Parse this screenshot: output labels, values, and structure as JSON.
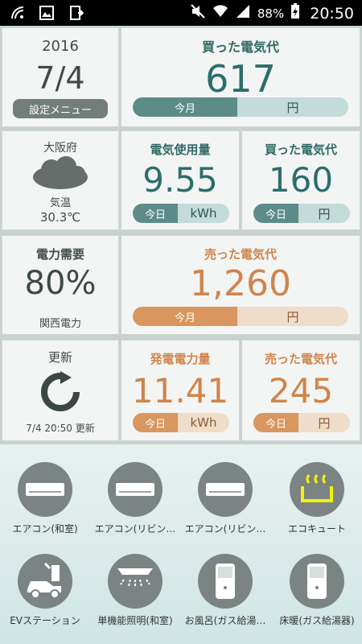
{
  "statusbar": {
    "battery": "88%",
    "time": "20:50"
  },
  "date_panel": {
    "year": "2016",
    "date": "7/4",
    "menu": "設定メニュー"
  },
  "bought_month": {
    "title": "買った電気代",
    "value": "617",
    "period": "今月",
    "unit": "円"
  },
  "weather": {
    "place": "大阪府",
    "temp_label": "気温",
    "temp": "30.3℃"
  },
  "usage_today": {
    "title": "電気使用量",
    "value": "9.55",
    "period": "今日",
    "unit": "kWh"
  },
  "bought_today": {
    "title": "買った電気代",
    "value": "160",
    "period": "今日",
    "unit": "円"
  },
  "demand": {
    "title": "電力需要",
    "value": "80%",
    "company": "関西電力"
  },
  "sold_month": {
    "title": "売った電気代",
    "value": "1,260",
    "period": "今月",
    "unit": "円"
  },
  "refresh": {
    "title": "更新",
    "stamp": "7/4 20:50 更新"
  },
  "generation_today": {
    "title": "発電電力量",
    "value": "11.41",
    "period": "今日",
    "unit": "kWh"
  },
  "sold_today": {
    "title": "売った電気代",
    "value": "245",
    "period": "今日",
    "unit": "円"
  },
  "devices": [
    {
      "label": "エアコン(和室)",
      "icon": "air-conditioner-icon"
    },
    {
      "label": "エアコン(リビン…",
      "icon": "air-conditioner-icon"
    },
    {
      "label": "エアコン(リビン…",
      "icon": "air-conditioner-icon"
    },
    {
      "label": "エコキュート",
      "icon": "water-heater-icon"
    },
    {
      "label": "EVステーション",
      "icon": "ev-station-icon"
    },
    {
      "label": "単機能照明(和室)",
      "icon": "ceiling-light-icon"
    },
    {
      "label": "お風呂(ガス給湯…",
      "icon": "bath-heater-icon"
    },
    {
      "label": "床暖(ガス給湯器)",
      "icon": "floor-heater-icon"
    }
  ]
}
